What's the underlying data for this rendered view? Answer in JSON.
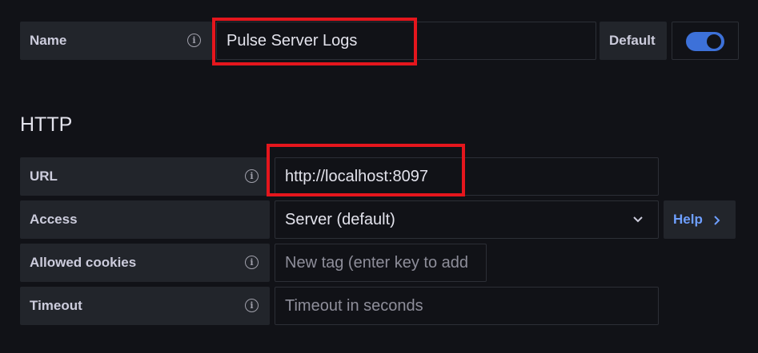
{
  "name_row": {
    "label": "Name",
    "info_icon": "info-icon",
    "value": "Pulse Server Logs",
    "default_label": "Default",
    "default_toggle_on": true
  },
  "http_section": {
    "title": "HTTP",
    "url": {
      "label": "URL",
      "info_icon": "info-icon",
      "value": "http://localhost:8097"
    },
    "access": {
      "label": "Access",
      "selected": "Server (default)",
      "dropdown_icon": "chevron-down-icon",
      "help_label": "Help",
      "help_icon": "chevron-right-icon"
    },
    "allowed_cookies": {
      "label": "Allowed cookies",
      "info_icon": "info-icon",
      "placeholder": "New tag (enter key to add"
    },
    "timeout": {
      "label": "Timeout",
      "info_icon": "info-icon",
      "placeholder": "Timeout in seconds"
    }
  },
  "colors": {
    "background": "#111217",
    "label_bg": "#22252b",
    "toggle_on": "#3d71d9",
    "help_link": "#6e9fff",
    "highlight": "#e5161d"
  }
}
